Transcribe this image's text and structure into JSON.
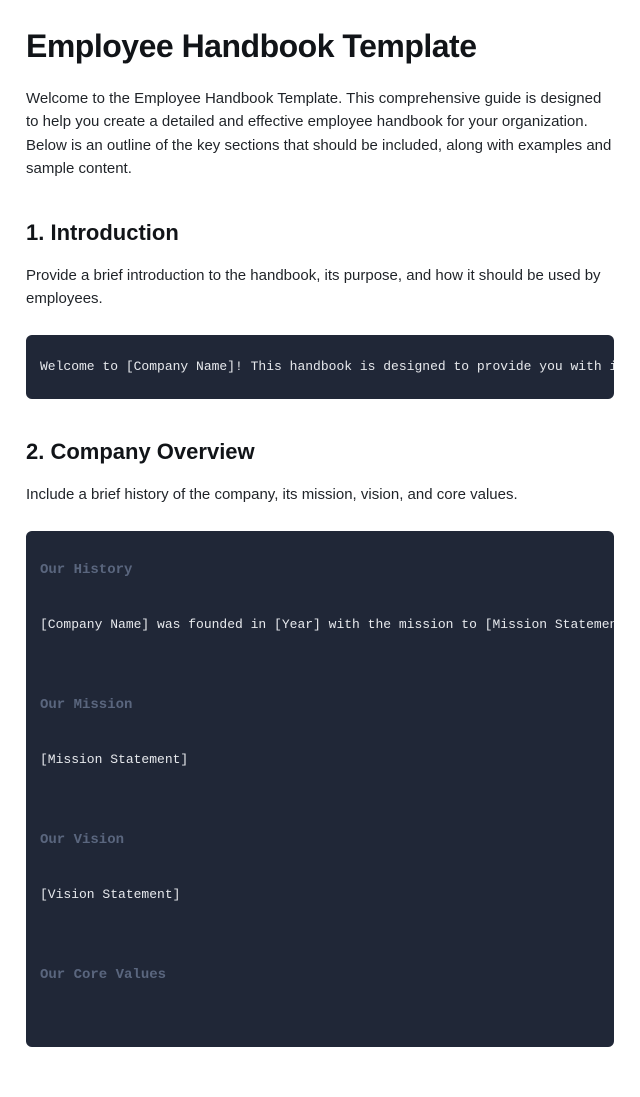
{
  "title": "Employee Handbook Template",
  "intro": "Welcome to the Employee Handbook Template. This comprehensive guide is designed to help you create a detailed and effective employee handbook for your organization. Below is an outline of the key sections that should be included, along with examples and sample content.",
  "s1": {
    "heading": "1. Introduction",
    "desc": "Provide a brief introduction to the handbook, its purpose, and how it should be used by employees.",
    "code": "Welcome to [Company Name]! This handbook is designed to provide you with important information"
  },
  "s2": {
    "heading": "2. Company Overview",
    "desc": "Include a brief history of the company, its mission, vision, and core values.",
    "h_history": "Our History",
    "t_history": "[Company Name] was founded in [Year] with the mission to [Mission Statement]. Over the",
    "h_mission": "Our Mission",
    "t_mission": "[Mission Statement]",
    "h_vision": "Our Vision",
    "t_vision": "[Vision Statement]",
    "h_values": "Our Core Values"
  }
}
